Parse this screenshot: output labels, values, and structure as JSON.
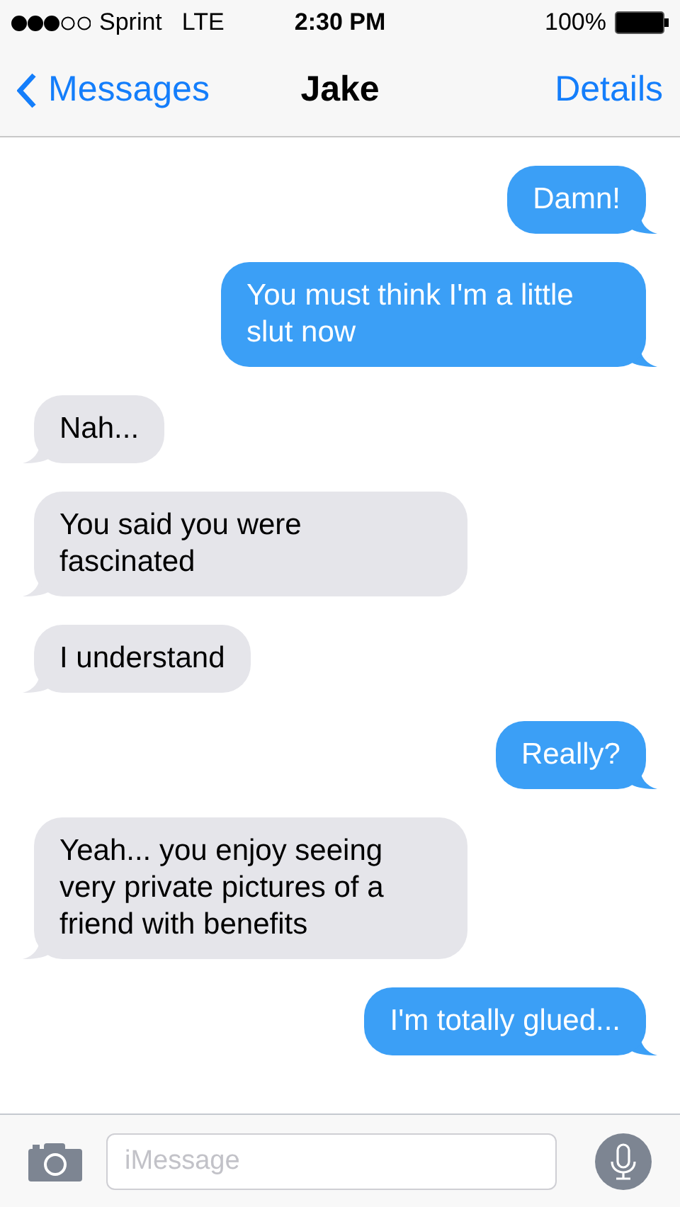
{
  "status_bar": {
    "carrier": "Sprint",
    "network": "LTE",
    "time": "2:30 PM",
    "battery": "100%"
  },
  "nav": {
    "back": "Messages",
    "title": "Jake",
    "action": "Details"
  },
  "messages": [
    {
      "text": "Damn!",
      "sent": true
    },
    {
      "text": "You must think I'm a little slut now",
      "sent": true
    },
    {
      "text": "Nah...",
      "sent": false
    },
    {
      "text": "You said you were fascinated",
      "sent": false
    },
    {
      "text": "I understand",
      "sent": false
    },
    {
      "text": "Really?",
      "sent": true
    },
    {
      "text": "Yeah... you enjoy seeing very private pictures of a friend with benefits",
      "sent": false
    },
    {
      "text": "I'm totally glued...",
      "sent": true
    }
  ],
  "composer": {
    "placeholder": "iMessage"
  }
}
